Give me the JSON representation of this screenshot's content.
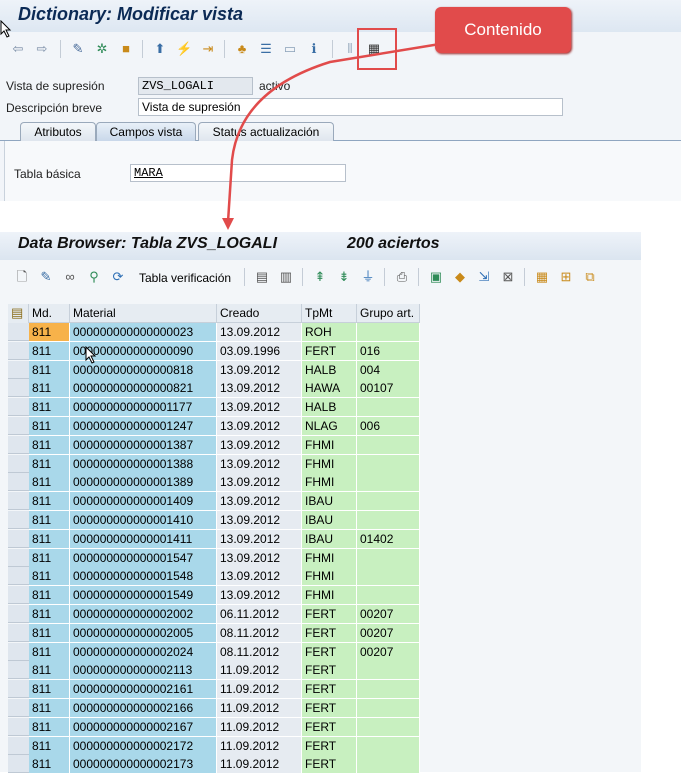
{
  "dictionary": {
    "title": "Dictionary: Modificar vista",
    "fields": {
      "vista_label": "Vista de supresión",
      "vista_value": "ZVS_LOGALI",
      "vista_status": "activo",
      "descr_label": "Descripción breve",
      "descr_value": "Vista de supresión",
      "tabla_label": "Tabla básica",
      "tabla_value": "MARA"
    },
    "tabs": [
      "Atributos",
      "Campos vista",
      "Status actualización"
    ]
  },
  "callout": {
    "text": "Contenido",
    "color": "#e14b4b"
  },
  "data_browser": {
    "title": "Data Browser: Tabla ZVS_LOGALI",
    "hits": "200 aciertos",
    "toolbar_text": "Tabla verificación",
    "columns": [
      "Md.",
      "Material",
      "Creado",
      "TpMt",
      "Grupo art."
    ],
    "rows": [
      [
        "811",
        "000000000000000023",
        "13.09.2012",
        "ROH",
        ""
      ],
      [
        "811",
        "000000000000000090",
        "03.09.1996",
        "FERT",
        "016"
      ],
      [
        "811",
        "000000000000000818",
        "13.09.2012",
        "HALB",
        "004"
      ],
      [
        "811",
        "000000000000000821",
        "13.09.2012",
        "HAWA",
        "00107"
      ],
      [
        "811",
        "000000000000001177",
        "13.09.2012",
        "HALB",
        ""
      ],
      [
        "811",
        "000000000000001247",
        "13.09.2012",
        "NLAG",
        "006"
      ],
      [
        "811",
        "000000000000001387",
        "13.09.2012",
        "FHMI",
        ""
      ],
      [
        "811",
        "000000000000001388",
        "13.09.2012",
        "FHMI",
        ""
      ],
      [
        "811",
        "000000000000001389",
        "13.09.2012",
        "FHMI",
        ""
      ],
      [
        "811",
        "000000000000001409",
        "13.09.2012",
        "IBAU",
        ""
      ],
      [
        "811",
        "000000000000001410",
        "13.09.2012",
        "IBAU",
        ""
      ],
      [
        "811",
        "000000000000001411",
        "13.09.2012",
        "IBAU",
        "01402"
      ],
      [
        "811",
        "000000000000001547",
        "13.09.2012",
        "FHMI",
        ""
      ],
      [
        "811",
        "000000000000001548",
        "13.09.2012",
        "FHMI",
        ""
      ],
      [
        "811",
        "000000000000001549",
        "13.09.2012",
        "FHMI",
        ""
      ],
      [
        "811",
        "000000000000002002",
        "06.11.2012",
        "FERT",
        "00207"
      ],
      [
        "811",
        "000000000000002005",
        "08.11.2012",
        "FERT",
        "00207"
      ],
      [
        "811",
        "000000000000002024",
        "08.11.2012",
        "FERT",
        "00207"
      ],
      [
        "811",
        "000000000000002113",
        "11.09.2012",
        "FERT",
        ""
      ],
      [
        "811",
        "000000000000002161",
        "11.09.2012",
        "FERT",
        ""
      ],
      [
        "811",
        "000000000000002166",
        "11.09.2012",
        "FERT",
        ""
      ],
      [
        "811",
        "000000000000002167",
        "11.09.2012",
        "FERT",
        ""
      ],
      [
        "811",
        "000000000000002172",
        "11.09.2012",
        "FERT",
        ""
      ],
      [
        "811",
        "000000000000002173",
        "11.09.2012",
        "FERT",
        ""
      ]
    ]
  }
}
